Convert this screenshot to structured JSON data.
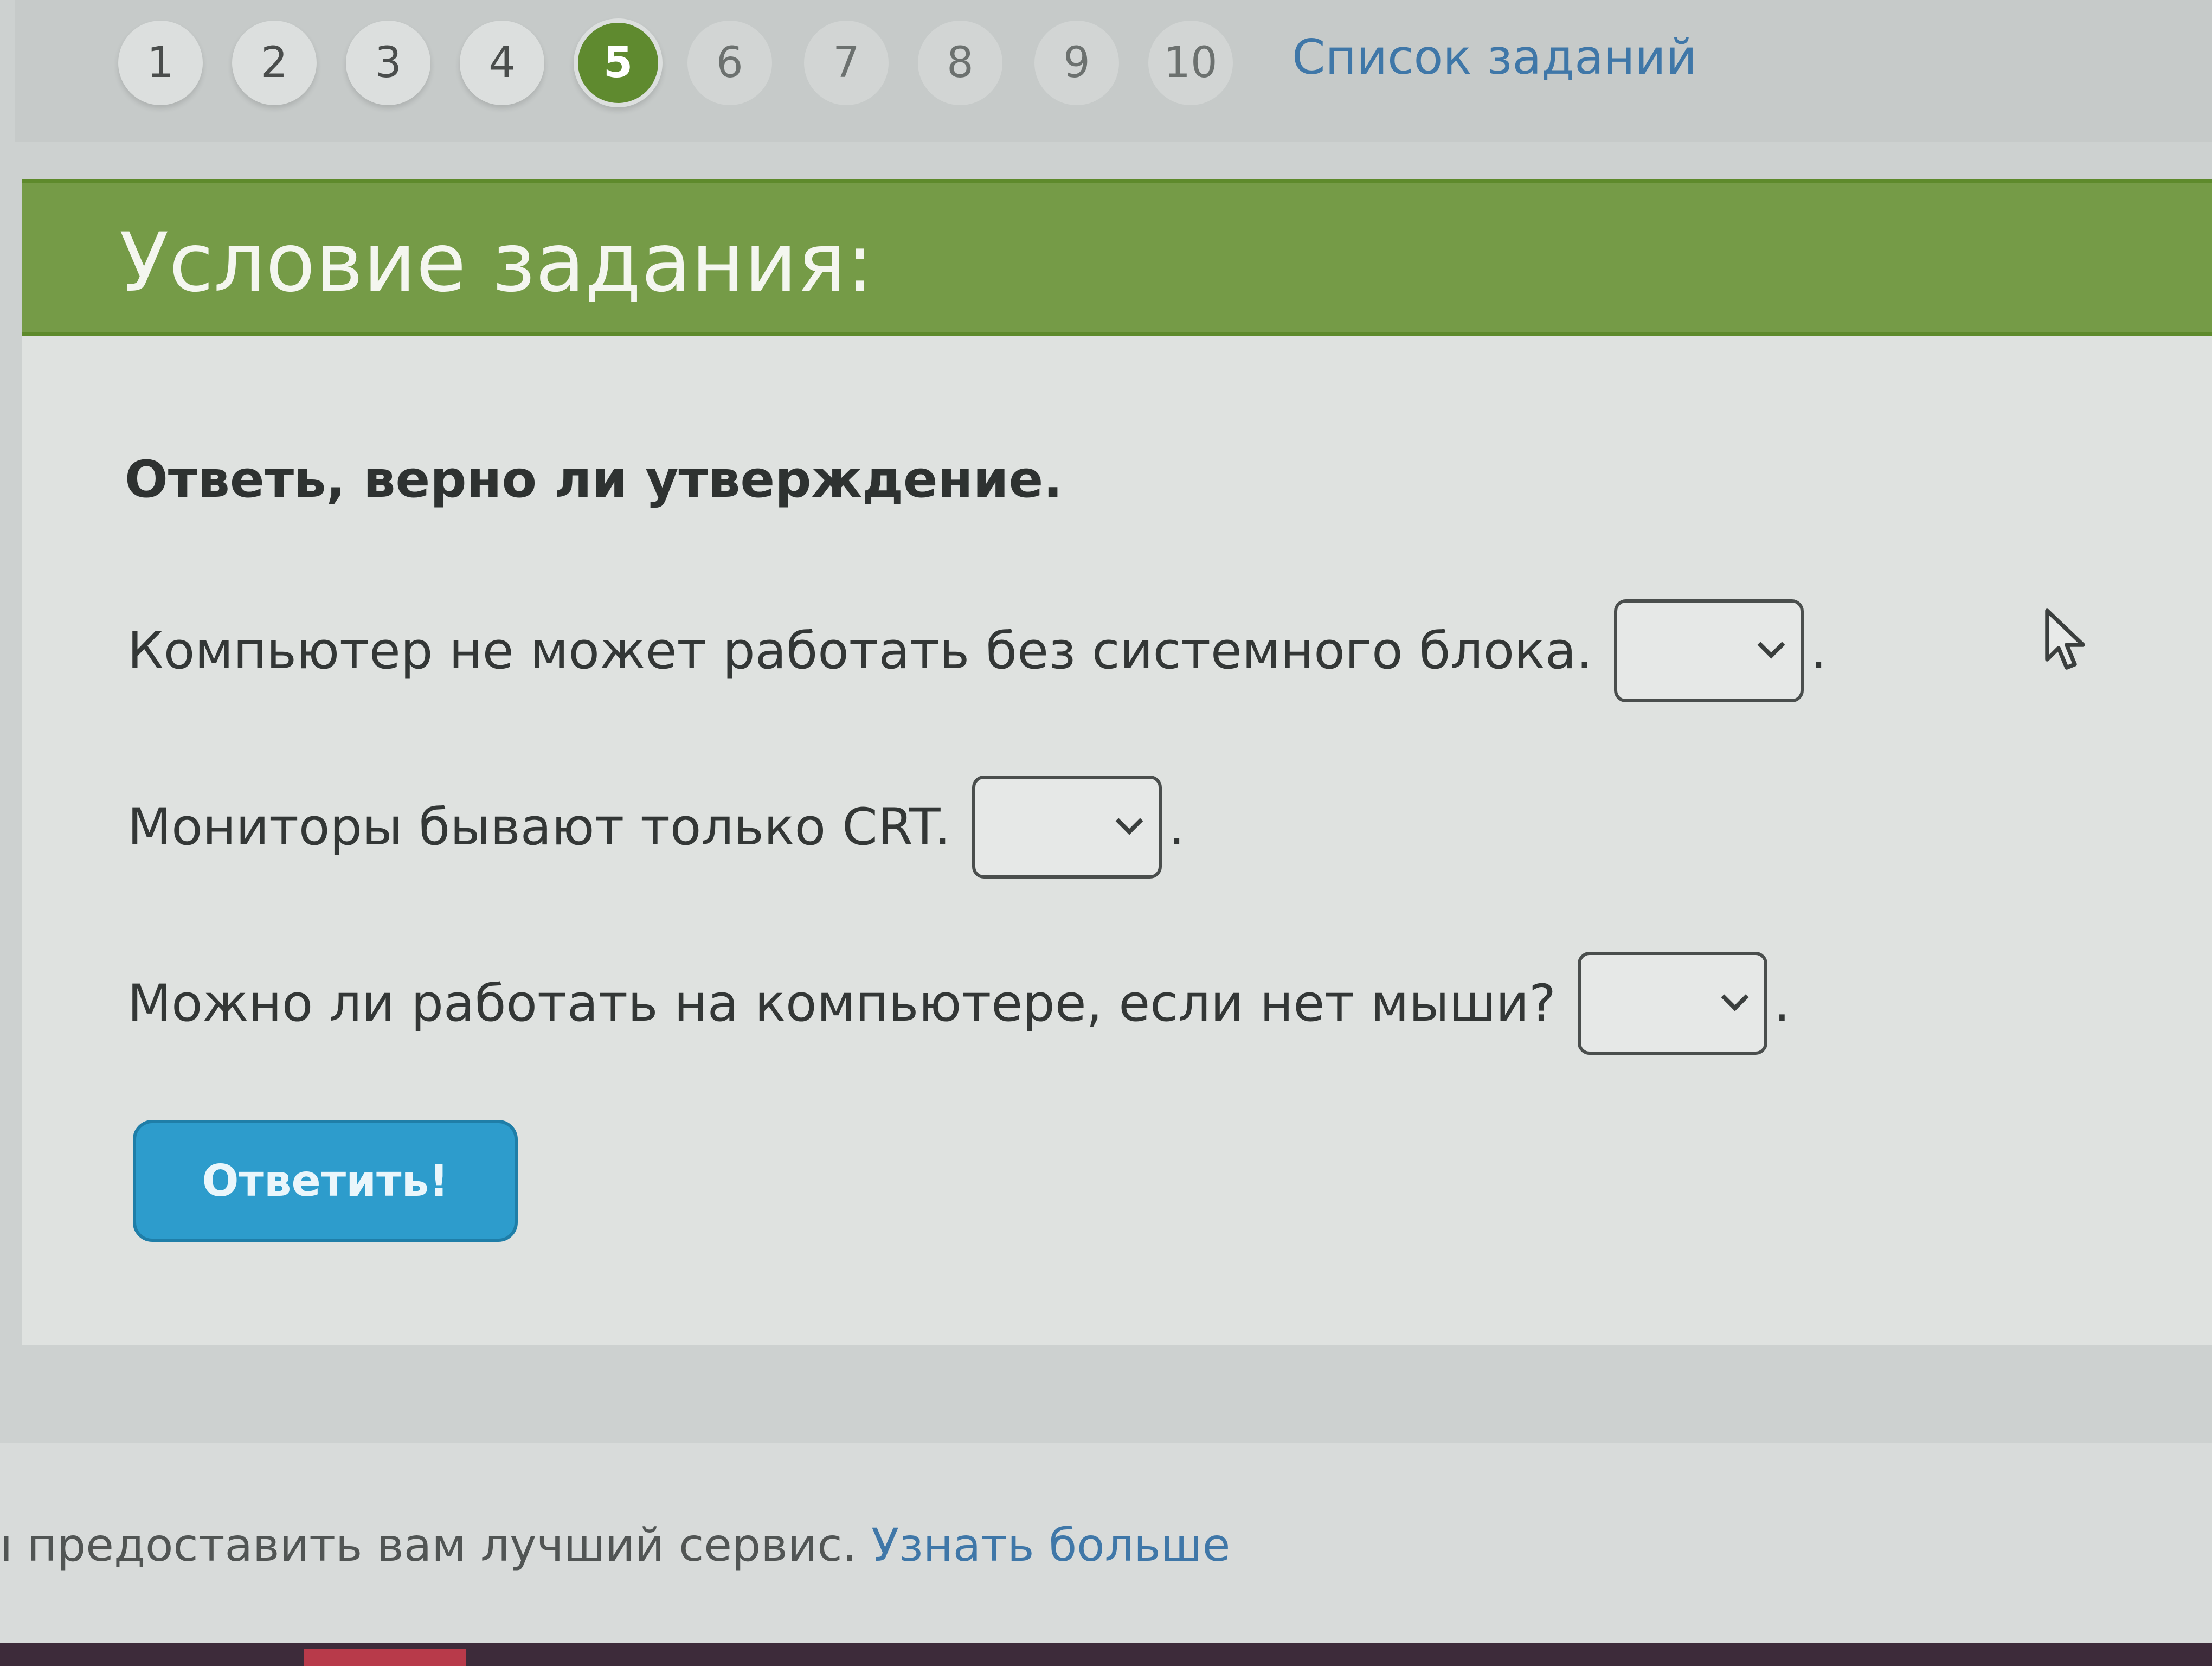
{
  "pagination": {
    "items": [
      "1",
      "2",
      "3",
      "4",
      "5",
      "6",
      "7",
      "8",
      "9",
      "10"
    ],
    "active": "5",
    "task_list_label": "Список заданий"
  },
  "task": {
    "header_title": "Условие задания:",
    "instruction": "Ответь, верно ли утверждение.",
    "questions": [
      {
        "text": "Компьютер не может работать без системного блока.",
        "selected": "",
        "suffix": "."
      },
      {
        "text": "Мониторы бывают только CRT.",
        "selected": "",
        "suffix": "."
      },
      {
        "text": "Можно ли работать на компьютере, если нет мыши?",
        "selected": "",
        "suffix": "."
      }
    ],
    "submit_label": "Ответить!"
  },
  "cookie_notice": {
    "text": "ı предоставить вам лучший сервис. ",
    "link_label": "Узнать больше"
  },
  "colors": {
    "header_green": "#759b47",
    "active_page": "#5f8a2f",
    "submit_blue": "#2d9ccc",
    "link_blue": "#3f77a8"
  },
  "icons": {
    "cursor": "mouse-pointer-icon",
    "select": "chevron-down-icon"
  }
}
